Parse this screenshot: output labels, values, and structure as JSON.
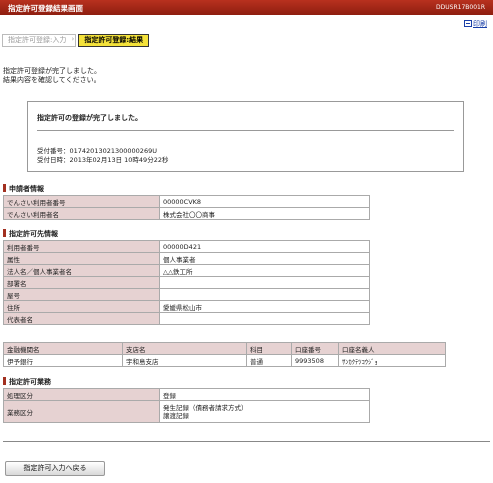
{
  "header": {
    "title": "指定許可登録結果画面",
    "screen_id": "DDUSR17B001R"
  },
  "print": {
    "label": "印刷"
  },
  "steps": [
    {
      "label": "指定許可登録:入力",
      "state": "done"
    },
    {
      "label": "指定許可登録:結果",
      "state": "current"
    }
  ],
  "message": {
    "line1": "指定許可登録が完了しました。",
    "line2": "結果内容を確認してください。"
  },
  "result": {
    "title": "指定許可の登録が完了しました。",
    "receipt_no": "受付番号：0174201302130000026​9U",
    "receipt_datetime": "受付日時：2013年02月13日 10時49分22秒"
  },
  "sections": {
    "applicant": "申請者情報",
    "permit_dest": "指定許可先情報",
    "business": "指定許可業務"
  },
  "applicant_rows": [
    {
      "label": "でんさい利用者番号",
      "value": "00000CVK8"
    },
    {
      "label": "でんさい利用者名",
      "value": "株式会社〇〇商事"
    }
  ],
  "permit_rows": [
    {
      "label": "利用者番号",
      "value": "00000D421"
    },
    {
      "label": "属性",
      "value": "個人事業者"
    },
    {
      "label": "法人名／個人事業者名",
      "value": "△△鉄工所"
    },
    {
      "label": "部署名",
      "value": ""
    },
    {
      "label": "屋号",
      "value": ""
    },
    {
      "label": "住所",
      "value": "愛媛県松山市"
    },
    {
      "label": "代表者名",
      "value": ""
    }
  ],
  "bank": {
    "headers": [
      "金融機関名",
      "支店名",
      "科目",
      "口座番号",
      "口座名義人"
    ],
    "row": [
      "伊予銀行",
      "宇和島支店",
      "普通",
      "9993508",
      "ｻﾝｶｸﾃﾂｺｳｼﾞｮ"
    ]
  },
  "business_rows": [
    {
      "label": "処理区分",
      "value": "登録"
    },
    {
      "label": "業務区分",
      "value": "発生記録（債務者請求方式）",
      "value2": "譲渡記録"
    }
  ],
  "back_button": "指定許可入力へ戻る"
}
